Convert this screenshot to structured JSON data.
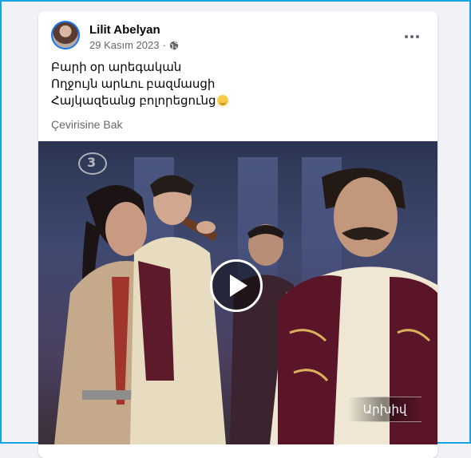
{
  "post": {
    "author": "Lilit Abelyan",
    "date": "29 Kasım 2023",
    "separator": "·",
    "privacy_icon": "globe-icon",
    "more_icon": "ellipsis-icon",
    "text_lines": [
      "Բարի օր արեգական",
      "Ողջույն արևու բազմասցի",
      "Հայկազեանց բոլորեցունց"
    ],
    "emoji": "smiling-face-emoji",
    "translate_label": "Çevirisine Bak"
  },
  "video": {
    "watermark": "3",
    "caption": "Արխիվ",
    "play_icon": "play-icon"
  },
  "colors": {
    "frame_border": "#16a3e6",
    "background": "#f0f2f5",
    "card": "#ffffff",
    "accent": "#1877f2",
    "secondary_text": "#65676b"
  }
}
